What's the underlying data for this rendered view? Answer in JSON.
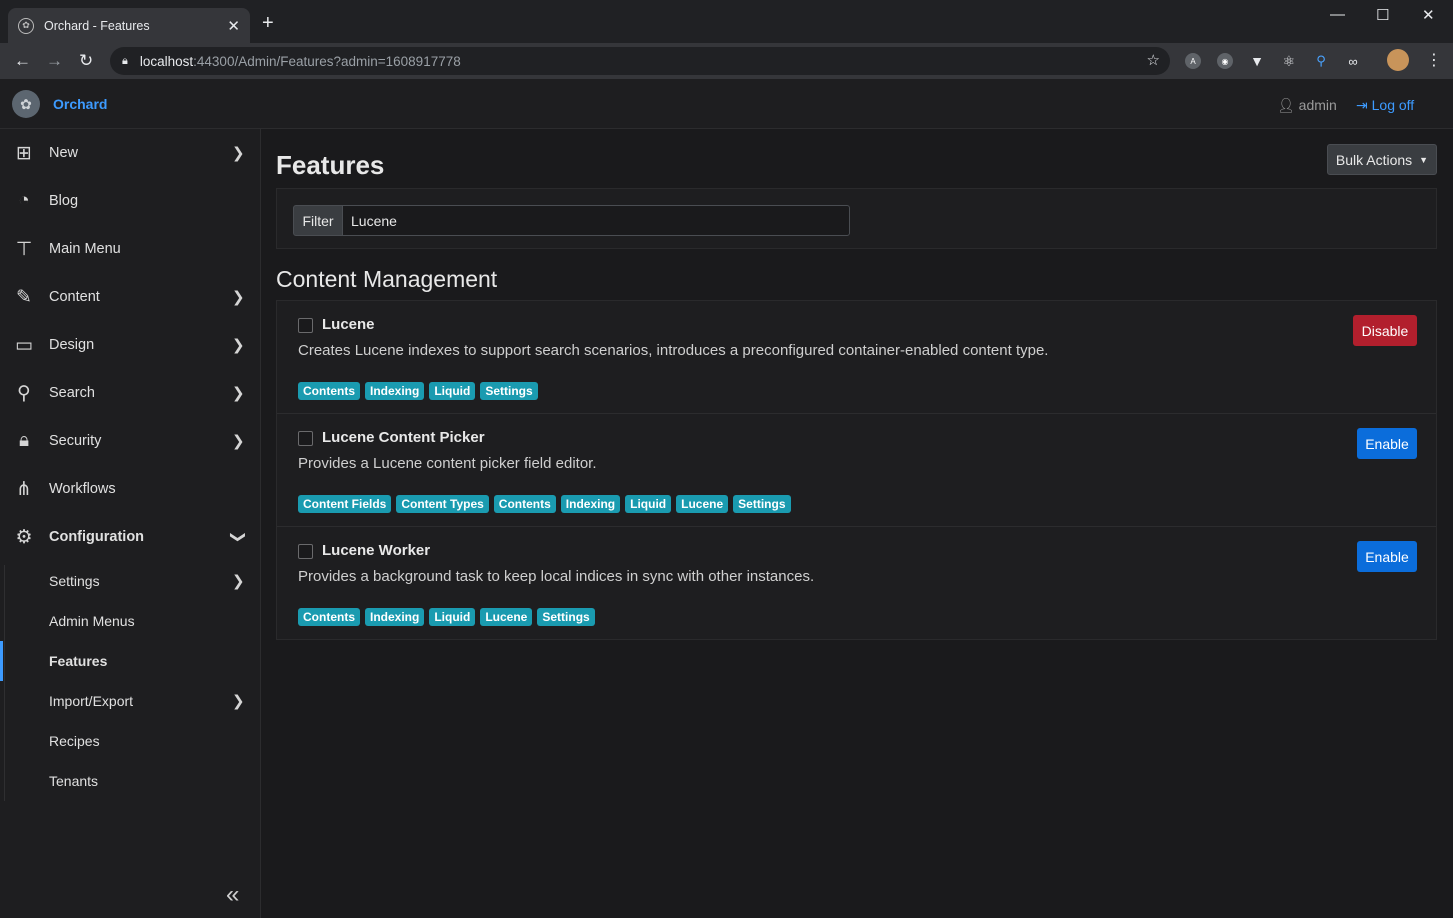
{
  "browser": {
    "tab_title": "Orchard - Features",
    "url_host": "localhost",
    "url_rest": ":44300/Admin/Features?admin=1608917778"
  },
  "header": {
    "brand": "Orchard",
    "user": "admin",
    "logoff": "Log off"
  },
  "sidebar": {
    "items": [
      {
        "label": "New",
        "icon": "plus-square-icon",
        "chevron": true
      },
      {
        "label": "Blog",
        "icon": "rss-icon",
        "chevron": false
      },
      {
        "label": "Main Menu",
        "icon": "sitemap-icon",
        "chevron": false
      },
      {
        "label": "Content",
        "icon": "edit-icon",
        "chevron": true
      },
      {
        "label": "Design",
        "icon": "desktop-icon",
        "chevron": true
      },
      {
        "label": "Search",
        "icon": "search-icon",
        "chevron": true
      },
      {
        "label": "Security",
        "icon": "lock-icon",
        "chevron": true
      },
      {
        "label": "Workflows",
        "icon": "workflow-icon",
        "chevron": false
      },
      {
        "label": "Configuration",
        "icon": "gear-icon",
        "chevron": true
      }
    ],
    "config_items": [
      {
        "label": "Settings",
        "chevron": true
      },
      {
        "label": "Admin Menus",
        "chevron": false
      },
      {
        "label": "Features",
        "chevron": false,
        "active": true
      },
      {
        "label": "Import/Export",
        "chevron": true
      },
      {
        "label": "Recipes",
        "chevron": false
      },
      {
        "label": "Tenants",
        "chevron": false
      }
    ]
  },
  "main": {
    "title": "Features",
    "bulk_actions": "Bulk Actions",
    "filter_label": "Filter",
    "filter_value": "Lucene",
    "section": "Content Management",
    "features": [
      {
        "name": "Lucene",
        "description": "Creates Lucene indexes to support search scenarios, introduces a preconfigured container-enabled content type.",
        "tags": [
          "Contents",
          "Indexing",
          "Liquid",
          "Settings"
        ],
        "action": "Disable"
      },
      {
        "name": "Lucene Content Picker",
        "description": "Provides a Lucene content picker field editor.",
        "tags": [
          "Content Fields",
          "Content Types",
          "Contents",
          "Indexing",
          "Liquid",
          "Lucene",
          "Settings"
        ],
        "action": "Enable"
      },
      {
        "name": "Lucene Worker",
        "description": "Provides a background task to keep local indices in sync with other instances.",
        "tags": [
          "Contents",
          "Indexing",
          "Liquid",
          "Lucene",
          "Settings"
        ],
        "action": "Enable"
      }
    ]
  },
  "colors": {
    "accent": "#3d9bff",
    "tag": "#1a9bb0",
    "disable": "#b21f2d",
    "enable": "#0b6ddb"
  }
}
